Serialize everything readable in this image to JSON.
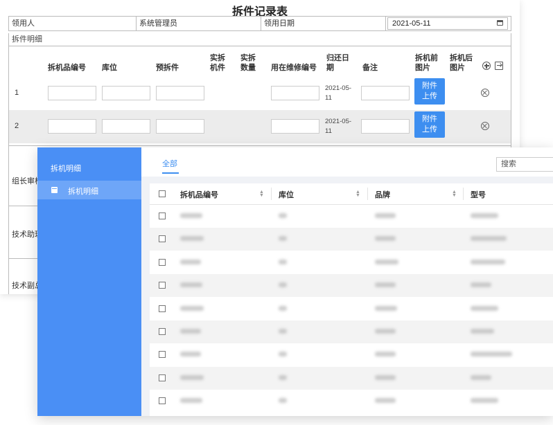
{
  "record_form": {
    "title": "拆件记录表",
    "recipient_label": "领用人",
    "recipient_value": "系统管理员",
    "date_label": "领用日期",
    "date_value": "2021-05-11",
    "section_label": "拆件明细",
    "columns": [
      "拆机品编号",
      "库位",
      "预拆件",
      "实拆机件",
      "实拆数量",
      "用在维修编号",
      "归还日期",
      "备注",
      "拆机前图片",
      "拆机后图片"
    ],
    "rows": [
      {
        "index": "1",
        "return_date": "2021-05-11",
        "upload_label": "附件上传"
      },
      {
        "index": "2",
        "return_date": "2021-05-11",
        "upload_label": "附件上传"
      }
    ],
    "sign_labels": [
      "组长审核",
      "技术助理",
      "技术副总"
    ]
  },
  "list_window": {
    "sidebar": {
      "title": "拆机明细",
      "items": [
        {
          "label": "拆机明细",
          "icon": "calendar-icon"
        }
      ]
    },
    "tab_all": "全部",
    "search_placeholder": "搜索",
    "columns": [
      "拆机品编号",
      "库位",
      "品牌",
      "型号"
    ],
    "row_count": 9
  },
  "colors": {
    "accent": "#3d8ef0",
    "sidebar": "#4a8ff5",
    "sidebar_active": "#6ea6f8"
  }
}
